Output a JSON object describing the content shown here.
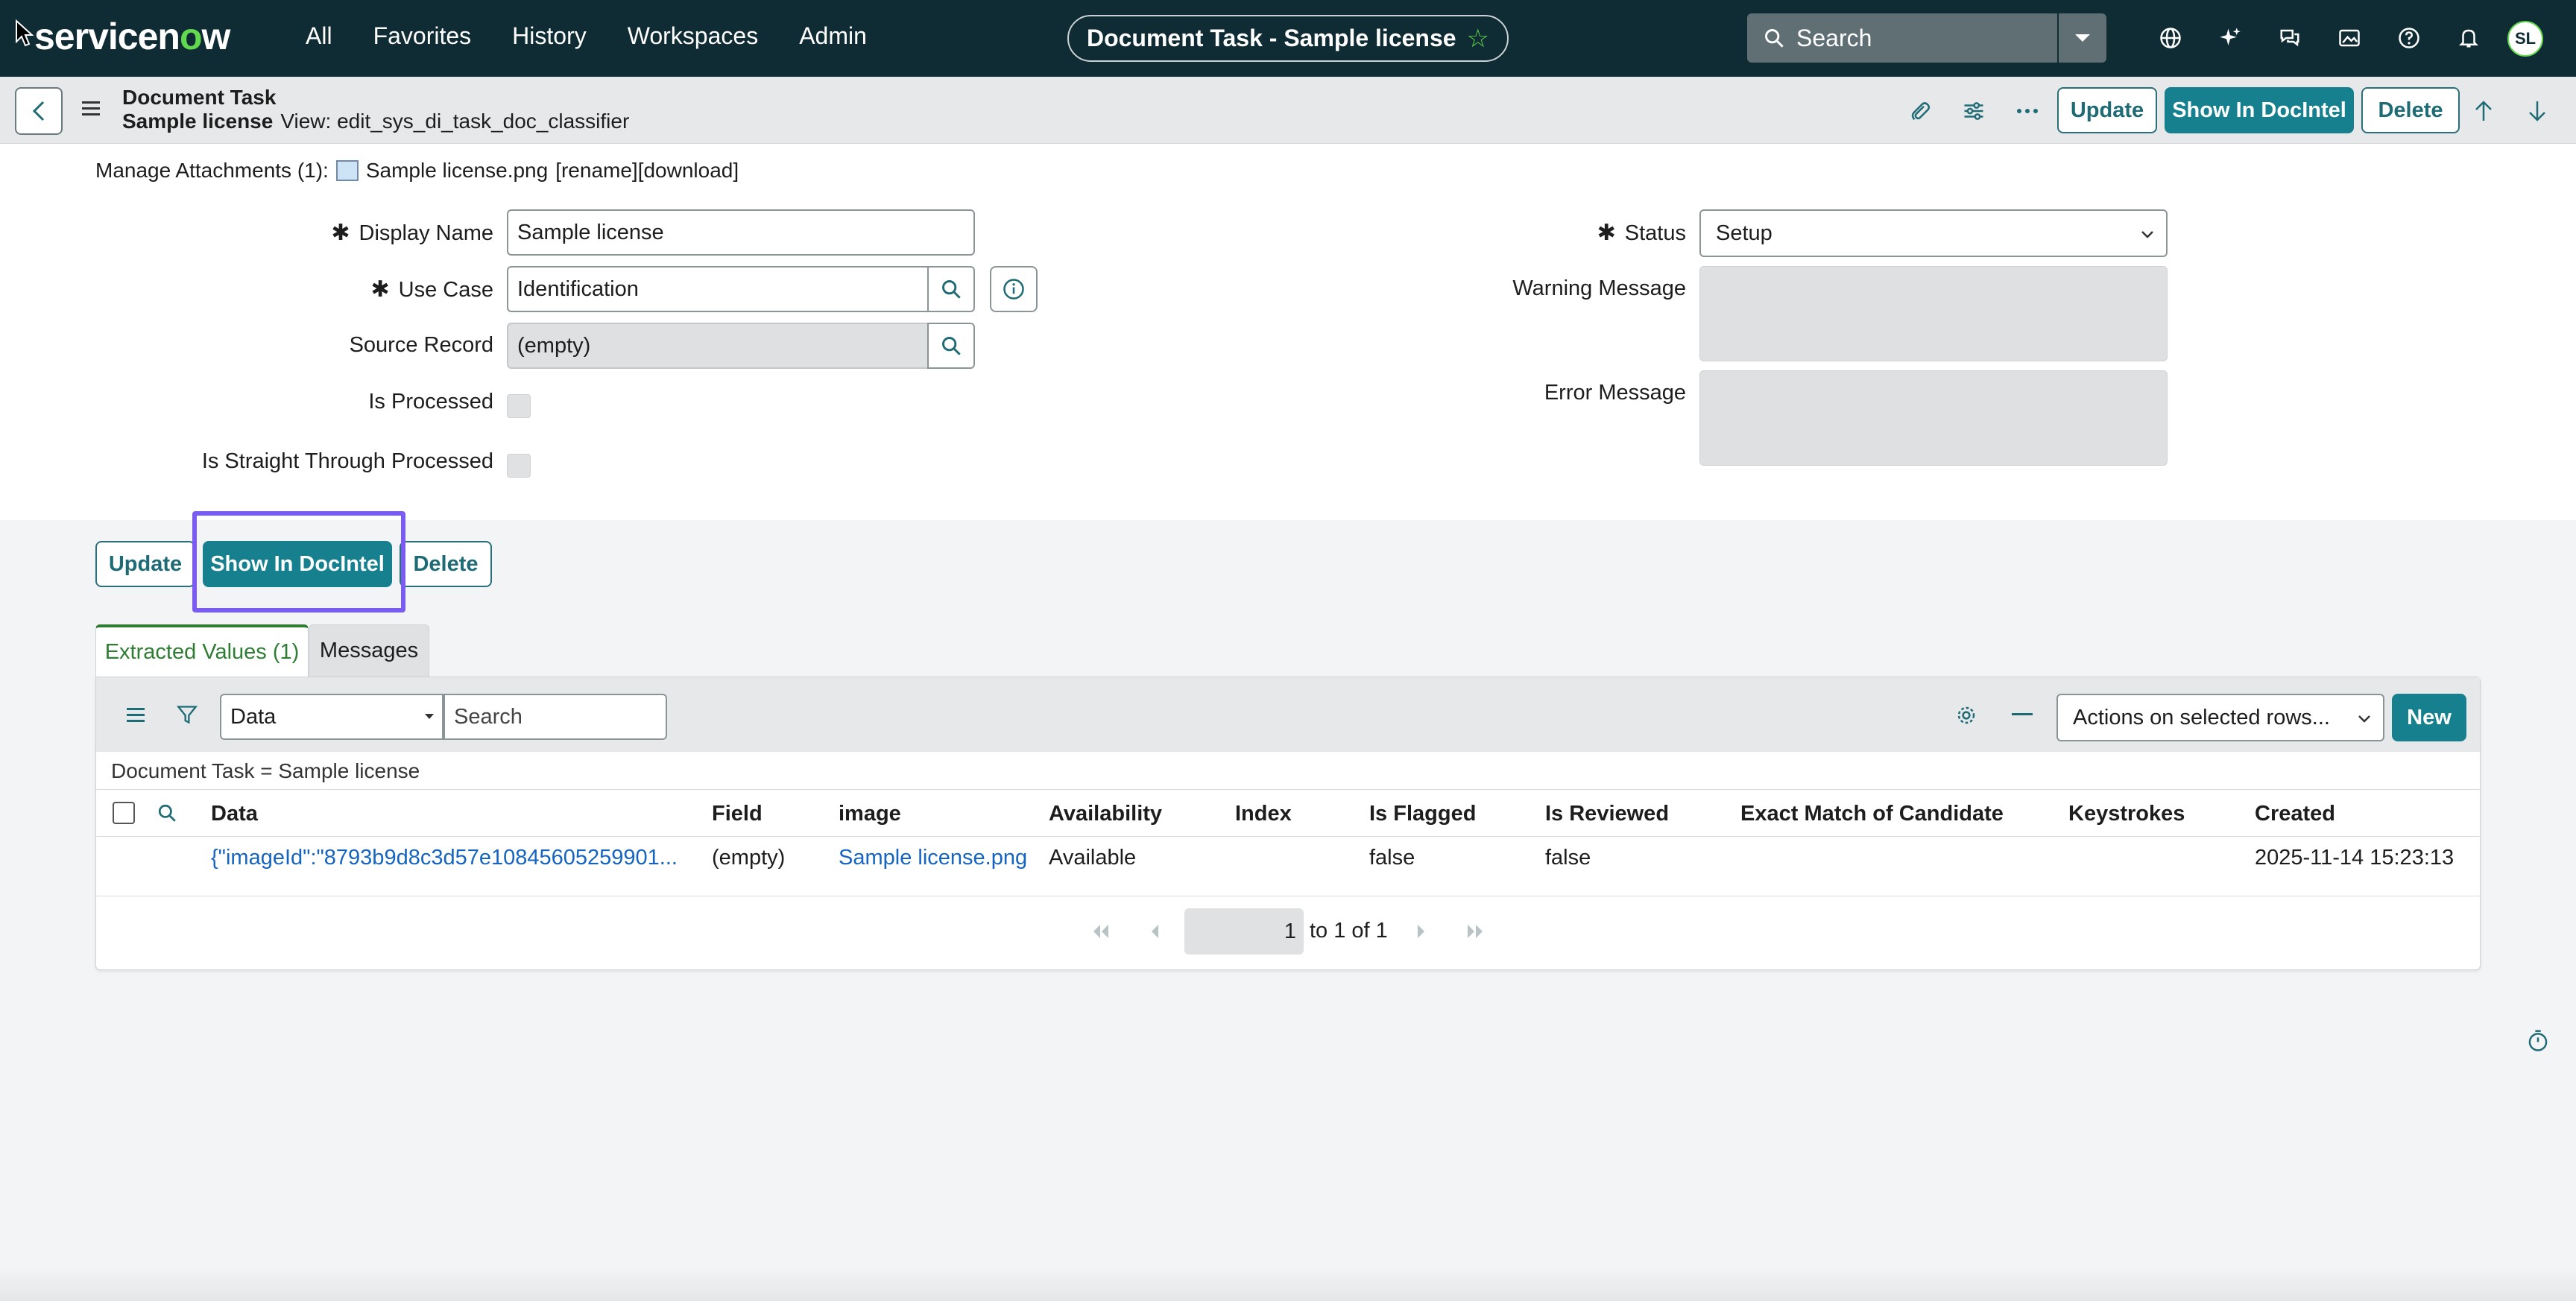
{
  "topnav": {
    "logo": {
      "prefix": "servicen",
      "o": "o",
      "suffix": "w"
    },
    "links": [
      "All",
      "Favorites",
      "History",
      "Workspaces",
      "Admin"
    ],
    "record_pill": "Document Task - Sample license",
    "search_placeholder": "Search",
    "avatar_initials": "SL"
  },
  "record_header": {
    "title": "Document Task",
    "subtitle": "Sample license",
    "view_label": "View: edit_sys_di_task_doc_classifier",
    "update_label": "Update",
    "show_label": "Show In DocIntel",
    "delete_label": "Delete"
  },
  "form": {
    "attachments_label": "Manage Attachments (1):",
    "attachment_file": "Sample license.png",
    "attachment_actions": "[rename][download]",
    "display_name_label": "Display Name",
    "display_name_value": "Sample license",
    "use_case_label": "Use Case",
    "use_case_value": "Identification",
    "source_record_label": "Source Record",
    "source_record_value": "(empty)",
    "is_processed_label": "Is Processed",
    "is_stp_label": "Is Straight Through Processed",
    "status_label": "Status",
    "status_value": "Setup",
    "warning_label": "Warning Message",
    "error_label": "Error Message",
    "required_mark": "✱"
  },
  "actions": {
    "update_label": "Update",
    "show_label": "Show In DocIntel",
    "delete_label": "Delete"
  },
  "tabs": [
    {
      "label": "Extracted Values (1)"
    },
    {
      "label": "Messages"
    }
  ],
  "list": {
    "field_select": "Data",
    "search_placeholder": "Search",
    "actions_select": "Actions on selected rows...",
    "new_label": "New",
    "breadcrumb": "Document Task = Sample license",
    "columns": [
      "Data",
      "Field",
      "image",
      "Availability",
      "Index",
      "Is Flagged",
      "Is Reviewed",
      "Exact Match of Candidate",
      "Keystrokes",
      "Created"
    ],
    "rows": [
      {
        "data": "{\"imageId\":\"8793b9d8c3d57e10845605259901...",
        "field": "(empty)",
        "image": "Sample license.png",
        "availability": "Available",
        "index": "",
        "is_flagged": "false",
        "is_reviewed": "false",
        "exact_match": "",
        "keystrokes": "",
        "created": "2025-11-14 15:23:13"
      }
    ],
    "pager_value": "1",
    "pager_text": "to 1 of 1"
  },
  "colors": {
    "nav_bg": "#0f2b33",
    "accent": "#16808f",
    "brand_green": "#62d84e",
    "focus": "#7b5cf0"
  }
}
